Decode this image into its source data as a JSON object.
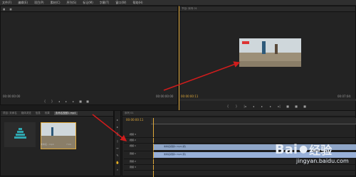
{
  "menu": [
    "文件(F)",
    "编辑(E)",
    "项目(P)",
    "素材(C)",
    "序列(S)",
    "标记(M)",
    "字幕(T)",
    "窗口(W)",
    "帮助(H)"
  ],
  "source": {
    "timecode_left": "00:00:00:00",
    "timecode_right": "00:00:00:00"
  },
  "program": {
    "tab": "节目: 序列 01",
    "timecode_left": "00:00:00:11",
    "timecode_right": "00:07:04:"
  },
  "project": {
    "tabs": [
      "项目: 未命名",
      "媒体浏览",
      "信息",
      "效果"
    ],
    "highlight_tab": "未命名视频1.mp4",
    "selected_clip_name": "未命名...mp4",
    "selected_clip_dur": "7:04"
  },
  "timeline": {
    "tab": "序列 01",
    "timecode": "00:00:00:11",
    "tracks": [
      "视频 3",
      "视频 2",
      "视频 1",
      "音频 1",
      "音频 2",
      "音频 3"
    ],
    "clip_label": "未命名视频1.mp4 [视]",
    "audio_clip_label": "未命名视频1.mp4 [音]"
  },
  "watermark": {
    "brand": "Bai",
    "brand2": "经验",
    "url": "jingyan.baidu.com"
  },
  "colors": {
    "accent": "#e0a93a",
    "clip_video": "#8fa6c8",
    "clip_audio": "#98b0d8",
    "arrow": "#d01c1c"
  }
}
